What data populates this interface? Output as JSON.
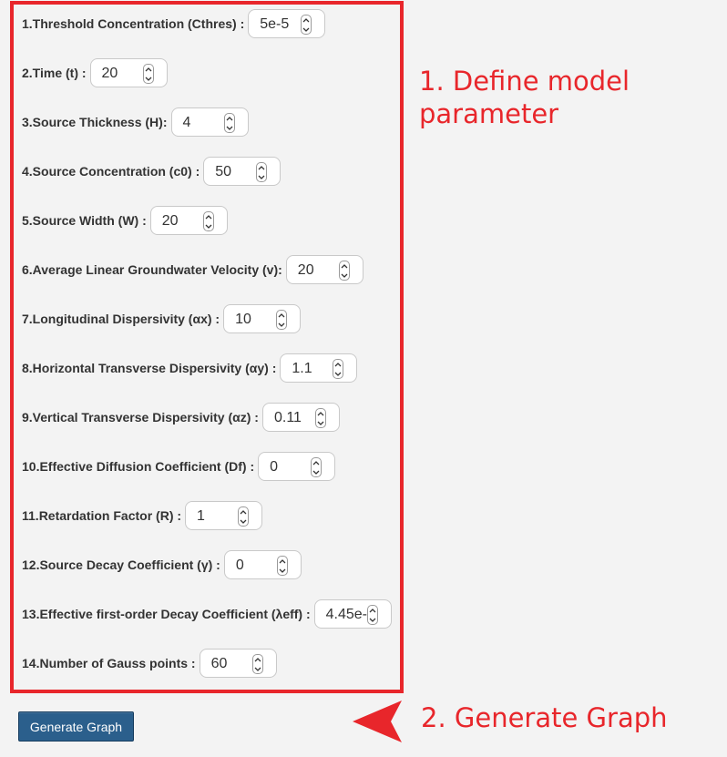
{
  "form": {
    "params": [
      {
        "label": "1.Threshold Concentration (Cthres) :",
        "value": "5e-5"
      },
      {
        "label": "2.Time (t) :",
        "value": "20"
      },
      {
        "label": "3.Source Thickness (H):",
        "value": "4"
      },
      {
        "label": "4.Source Concentration (c0) :",
        "value": "50"
      },
      {
        "label": "5.Source Width (W) :",
        "value": "20"
      },
      {
        "label": "6.Average Linear Groundwater Velocity (v):",
        "value": "20"
      },
      {
        "label": "7.Longitudinal Dispersivity (αx) :",
        "value": "10"
      },
      {
        "label": "8.Horizontal Transverse Dispersivity (αy) :",
        "value": "1.1"
      },
      {
        "label": "9.Vertical Transverse Dispersivity (αz) :",
        "value": "0.11"
      },
      {
        "label": "10.Effective Diffusion Coefficient (Df) :",
        "value": "0"
      },
      {
        "label": "11.Retardation Factor (R) :",
        "value": "1"
      },
      {
        "label": "12.Source Decay Coefficient (γ) :",
        "value": "0"
      },
      {
        "label": "13.Effective first-order Decay Coefficient (λeff) :",
        "value": "4.45e-"
      },
      {
        "label": "14.Number of Gauss points :",
        "value": "60"
      }
    ],
    "generate_label": "Generate Graph"
  },
  "annotations": {
    "step1": "1. Define model parameter",
    "step2": "2. Generate Graph"
  },
  "colors": {
    "highlight": "#e8262b",
    "button_bg": "#2b5f8c",
    "page_bg": "#f3f3f3"
  }
}
